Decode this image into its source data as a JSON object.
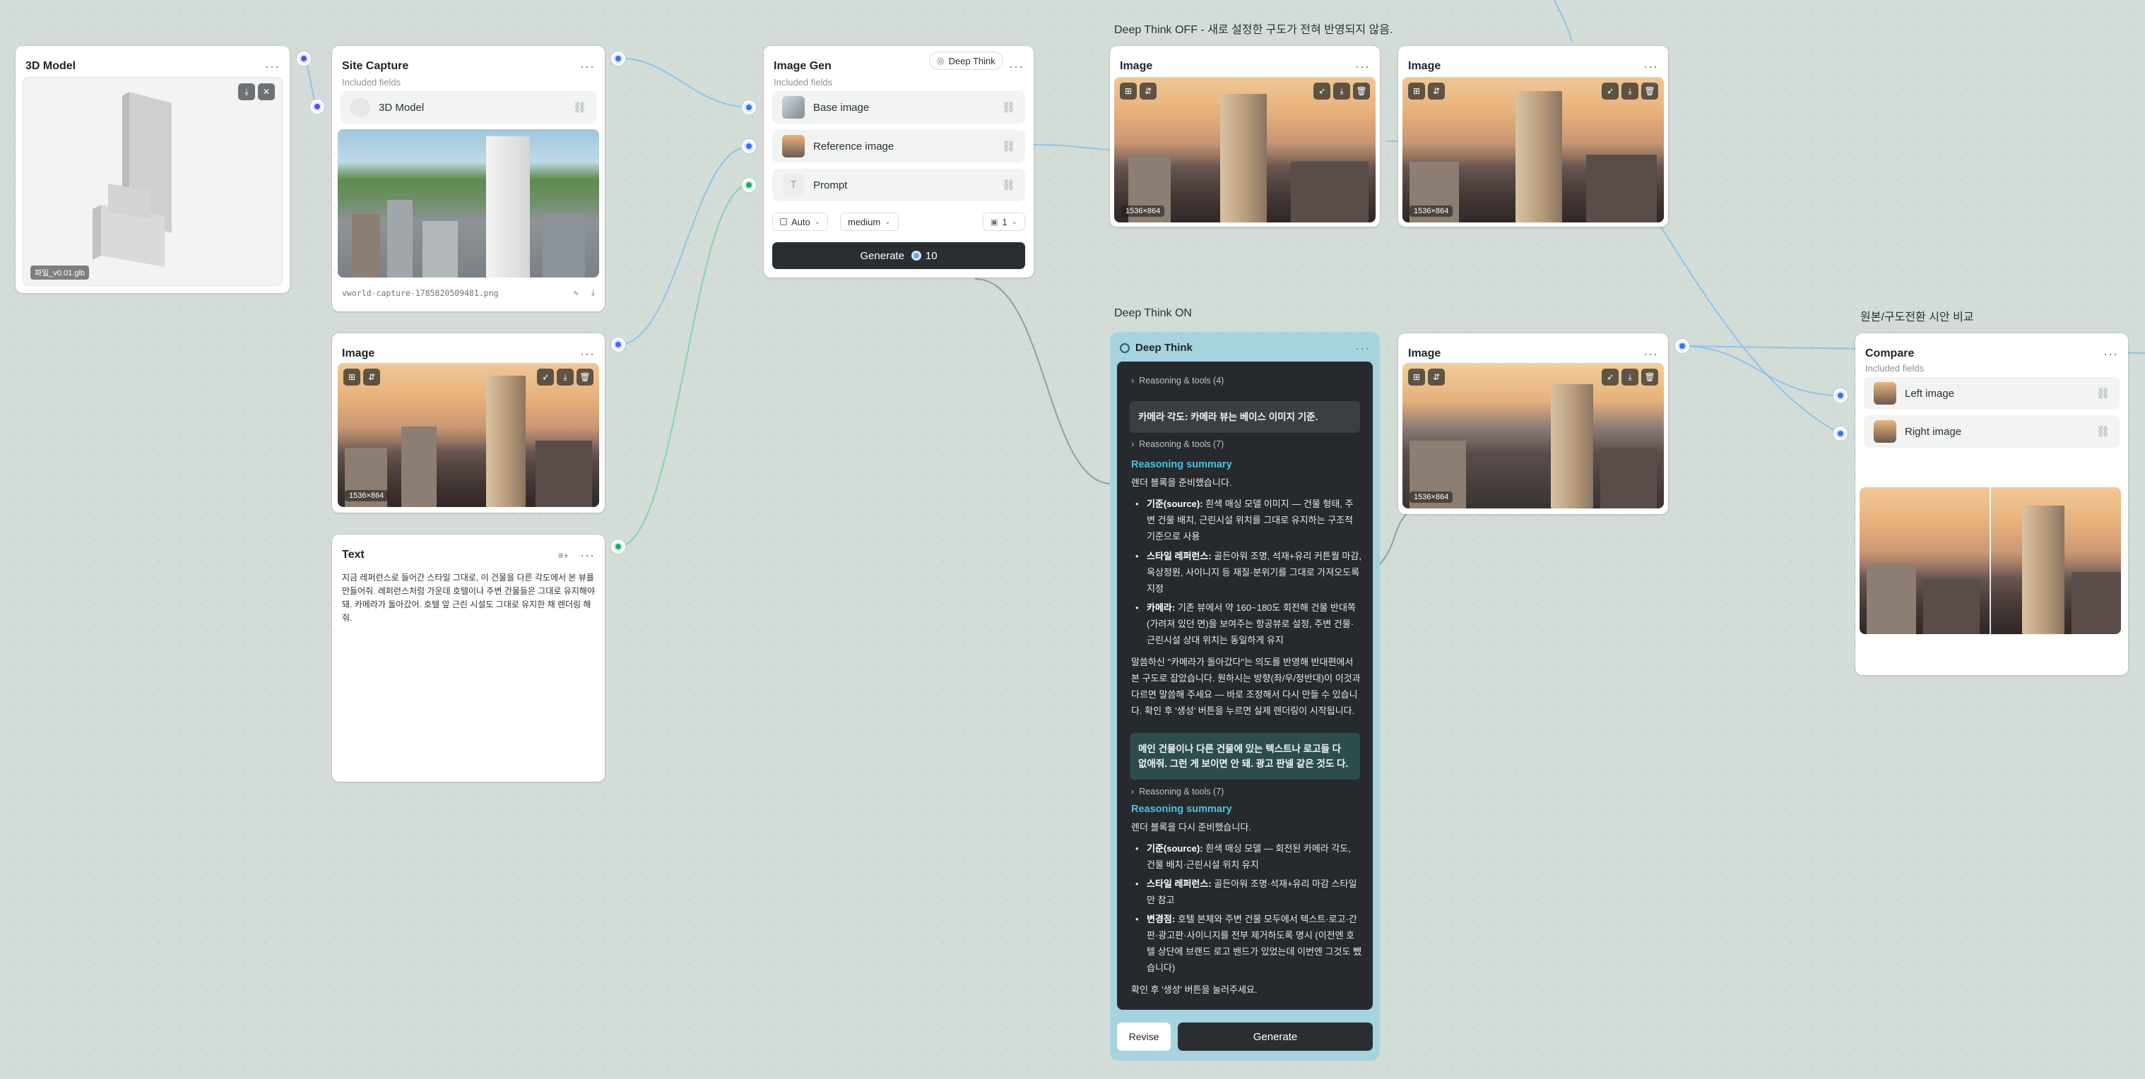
{
  "canvas": {
    "label_off": "Deep Think OFF - 새로 설정한 구도가 전혀 반영되지 않음.",
    "label_on": "Deep Think ON",
    "label_compare": "원본/구도전환 시안 비교"
  },
  "model_node": {
    "title": "3D Model",
    "menu": "···",
    "file_tag": "파일_v0.01.glb",
    "download_icon": "⤓",
    "close_icon": "✕"
  },
  "site_capture": {
    "title": "Site Capture",
    "menu": "···",
    "included_label": "Included fields",
    "field_label": "3D Model",
    "link_icon": "⛓",
    "filename": "vworld-capture-1785820509481.png",
    "edit_icon": "✎",
    "download_icon": "⤓"
  },
  "image_left": {
    "title": "Image",
    "menu": "···",
    "size": "1536×864"
  },
  "text_node": {
    "title": "Text",
    "menu": "···",
    "tool_icon": "≡+",
    "body": "지금 레퍼런스로 들어간 스타일 그대로, 이 건물을 다른 각도에서 본 뷰를 만들어줘. 레퍼런스처럼 가운데 호텔이나 주변 건물들은 그대로 유지해야 돼. 카메라가 돌아갔어. 호텔 앞 근린 시설도 그대로 유지한 채 렌더링 해줘."
  },
  "image_gen": {
    "title": "Image Gen",
    "deep_think_pill": "Deep Think",
    "menu": "···",
    "included_label": "Included fields",
    "fields": [
      {
        "label": "Base image"
      },
      {
        "label": "Reference image"
      },
      {
        "label": "Prompt"
      }
    ],
    "aspect": "Auto",
    "quality": "medium",
    "count": "1",
    "generate_label": "Generate",
    "credits": "10"
  },
  "image_top1": {
    "title": "Image",
    "menu": "···",
    "size": "1536×864"
  },
  "image_top2": {
    "title": "Image",
    "menu": "···",
    "size": "1536×864"
  },
  "image_mid": {
    "title": "Image",
    "menu": "···",
    "size": "1536×864"
  },
  "deep_think": {
    "title": "Deep Think",
    "menu": "···",
    "reasoning1": "Reasoning & tools (4)",
    "msg1": "카메라 각도: 카메라 뷰는 베이스 이미지 기준.",
    "reasoning2": "Reasoning & tools (7)",
    "summary_title": "Reasoning summary",
    "summary1_intro": "렌더 블록을 준비했습니다.",
    "summary1_bullets": [
      {
        "k": "기준(source):",
        "v": " 흰색 매싱 모델 이미지 — 건물 형태, 주변 건물 배치, 근린시설 위치를 그대로 유지하는 구조적 기준으로 사용"
      },
      {
        "k": "스타일 레퍼런스:",
        "v": " 골든아워 조명, 석재+유리 커튼월 마감, 옥상정원, 사이니지 등 재질·분위기를 그대로 가져오도록 지정"
      },
      {
        "k": "카메라:",
        "v": " 기존 뷰에서 약 160~180도 회전해 건물 반대쪽(가려져 있던 면)을 보여주는 항공뷰로 설정, 주변 건물·근린시설 상대 위치는 동일하게 유지"
      }
    ],
    "summary1_outro": "말씀하신 \"카메라가 돌아갔다\"는 의도를 반영해 반대편에서 본 구도로 잡았습니다. 원하시는 방향(좌/우/정반대)이 이것과 다르면 말씀해 주세요 — 바로 조정해서 다시 만들 수 있습니다. 확인 후 '생성' 버튼을 누르면 실제 렌더링이 시작됩니다.",
    "msg2": "메인 건물이나 다른 건물에 있는 텍스트나 로고들 다 없애줘. 그런 게 보이면 안 돼. 광고 판넬 같은 것도 다.",
    "reasoning3": "Reasoning & tools (7)",
    "summary2_title": "Reasoning summary",
    "summary2_intro": "렌더 블록을 다시 준비했습니다.",
    "summary2_bullets": [
      {
        "k": "기준(source):",
        "v": " 흰색 매싱 모델 — 회전된 카메라 각도, 건물 배치·근린시설 위치 유지"
      },
      {
        "k": "스타일 레퍼런스:",
        "v": " 골든아워 조명·석재+유리 마감 스타일만 참고"
      },
      {
        "k": "변경점:",
        "v": " 호텔 본체와 주변 건물 모두에서 텍스트·로고·간판·광고판·사이니지를 전부 제거하도록 명시 (이전엔 호텔 상단에 브랜드 로고 밴드가 있었는데 이번엔 그것도 뺐습니다)"
      }
    ],
    "summary2_outro": "확인 후 '생성' 버튼을 눌러주세요.",
    "revise_label": "Revise",
    "generate_label": "Generate"
  },
  "compare": {
    "title": "Compare",
    "menu": "···",
    "included_label": "Included fields",
    "fields": [
      {
        "label": "Left image"
      },
      {
        "label": "Right image"
      }
    ]
  },
  "colors": {
    "edge": "#8ec4e8",
    "port_blue": "#3b6ff0",
    "port_green": "#22a870",
    "deep_think_frame": "#a6d3de",
    "accent_summary": "#4fc0e0"
  }
}
